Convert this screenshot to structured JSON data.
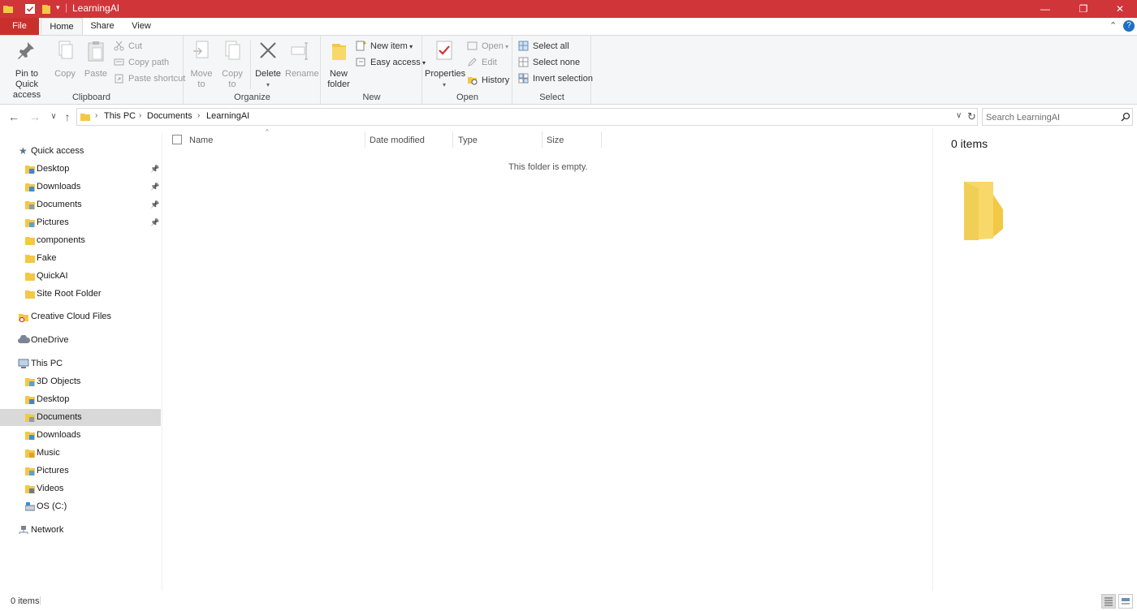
{
  "window": {
    "title": "LearningAI",
    "accent_color": "#d0353a",
    "controls": {
      "minimize": "—",
      "maximize": "❐",
      "close": "✕"
    }
  },
  "ribbon_tabs": [
    "File",
    "Home",
    "Share",
    "View"
  ],
  "ribbon": {
    "clipboard": {
      "label": "Clipboard",
      "pin_line1": "Pin to Quick",
      "pin_line2": "access",
      "copy": "Copy",
      "paste": "Paste",
      "cut": "Cut",
      "copy_path": "Copy path",
      "paste_shortcut": "Paste shortcut"
    },
    "organize": {
      "label": "Organize",
      "move_line1": "Move",
      "move_line2": "to",
      "copy_line1": "Copy",
      "copy_line2": "to",
      "delete": "Delete",
      "rename": "Rename"
    },
    "new": {
      "label": "New",
      "folder_line1": "New",
      "folder_line2": "folder",
      "new_item": "New item",
      "easy_access": "Easy access"
    },
    "open": {
      "label": "Open",
      "properties": "Properties",
      "open": "Open",
      "edit": "Edit",
      "history": "History"
    },
    "select": {
      "label": "Select",
      "select_all": "Select all",
      "select_none": "Select none",
      "invert": "Invert selection"
    }
  },
  "address": {
    "breadcrumbs": [
      "This PC",
      "Documents",
      "LearningAI"
    ],
    "search_placeholder": "Search LearningAI"
  },
  "nav_pane": {
    "quick_access": "Quick access",
    "quick_items": [
      {
        "label": "Desktop",
        "pinned": true
      },
      {
        "label": "Downloads",
        "pinned": true
      },
      {
        "label": "Documents",
        "pinned": true
      },
      {
        "label": "Pictures",
        "pinned": true
      },
      {
        "label": "components",
        "pinned": false
      },
      {
        "label": "Fake",
        "pinned": false
      },
      {
        "label": "QuickAI",
        "pinned": false
      },
      {
        "label": "Site Root Folder",
        "pinned": false
      }
    ],
    "creative_cloud": "Creative Cloud Files",
    "onedrive": "OneDrive",
    "this_pc": "This PC",
    "pc_items": [
      "3D Objects",
      "Desktop",
      "Documents",
      "Downloads",
      "Music",
      "Pictures",
      "Videos",
      "OS (C:)"
    ],
    "selected": "Documents",
    "network": "Network"
  },
  "content": {
    "columns": [
      "Name",
      "Date modified",
      "Type",
      "Size"
    ],
    "empty_message": "This folder is empty."
  },
  "preview": {
    "count": "0 items"
  },
  "status": {
    "count": "0 items"
  }
}
